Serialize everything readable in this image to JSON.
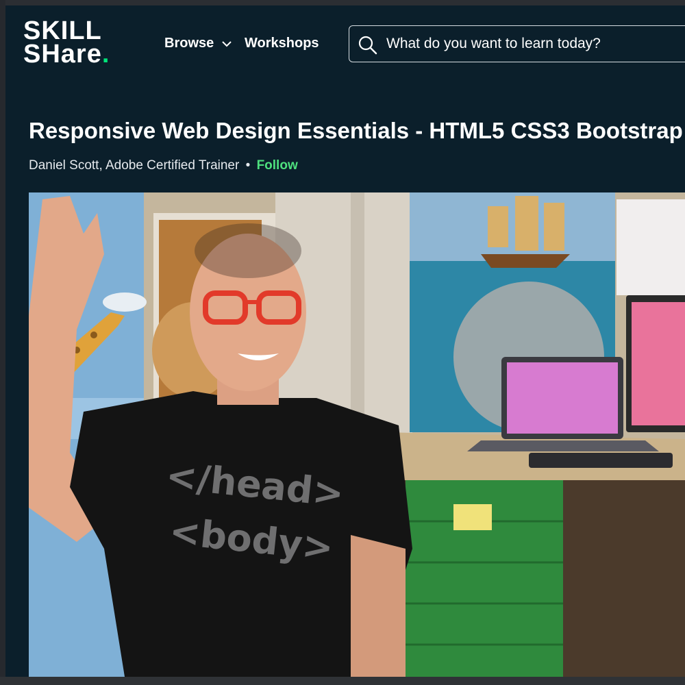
{
  "header": {
    "logo": {
      "line1": "SKILL",
      "line2": "SHare",
      "dot": "."
    },
    "nav": [
      {
        "label": "Browse",
        "has_dropdown": true
      },
      {
        "label": "Workshops",
        "has_dropdown": false
      }
    ],
    "search": {
      "placeholder": "What do you want to learn today?",
      "icon": "search-icon"
    }
  },
  "course": {
    "title": "Responsive Web Design Essentials - HTML5 CSS3 Bootstrap",
    "author": "Daniel Scott, Adobe Certified Trainer",
    "separator": "•",
    "follow_label": "Follow"
  },
  "video": {
    "shirt_text_line1": "</head>",
    "shirt_text_line2": "<body>"
  },
  "colors": {
    "background": "#0b1f2b",
    "accent": "#00e579",
    "follow": "#4ee07e",
    "text": "#ffffff"
  }
}
